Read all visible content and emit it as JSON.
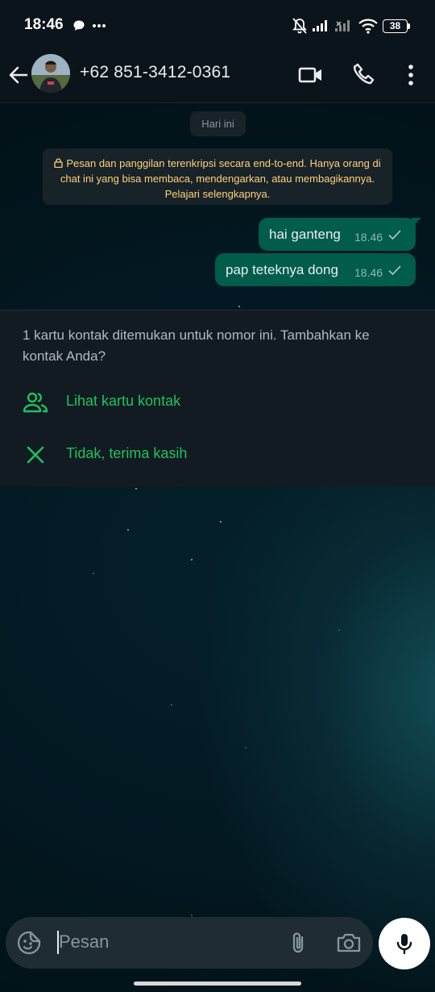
{
  "status_bar": {
    "time": "18:46",
    "battery": "38",
    "icons": [
      "chat-bubble-icon",
      "more-dots-icon",
      "bell-muted-icon",
      "signal-icon",
      "signal-no-service-icon",
      "wifi-icon",
      "battery-icon"
    ]
  },
  "header": {
    "contact_name": "+62 851-3412-0361",
    "icons": [
      "back-arrow-icon",
      "avatar",
      "video-call-icon",
      "voice-call-icon",
      "overflow-menu-icon"
    ]
  },
  "chat": {
    "date_chip": "Hari ini",
    "encryption_notice": "Pesan dan panggilan terenkripsi secara end-to-end. Hanya orang di chat ini yang bisa membaca, mendengarkan, atau membagikannya. Pelajari selengkapnya.",
    "messages": [
      {
        "text": "hai ganteng",
        "time": "18.46",
        "status": "sent"
      },
      {
        "text": "pap teteknya dong",
        "time": "18.46",
        "status": "sent"
      }
    ]
  },
  "contact_prompt": {
    "text": "1 kartu kontak ditemukan untuk nomor ini. Tambahkan ke kontak Anda?",
    "view_card_label": "Lihat kartu kontak",
    "dismiss_label": "Tidak, terima kasih"
  },
  "composer": {
    "placeholder": "Pesan",
    "icons": [
      "sticker-icon",
      "attach-icon",
      "camera-icon",
      "microphone-icon"
    ]
  },
  "colors": {
    "header_bg": "#0b141a",
    "outgoing_bubble": "#005c4b",
    "accent_green": "#21c063",
    "notice_text": "#ffd279",
    "prompt_bg": "#111b21",
    "composer_bg": "#1f2c33"
  }
}
